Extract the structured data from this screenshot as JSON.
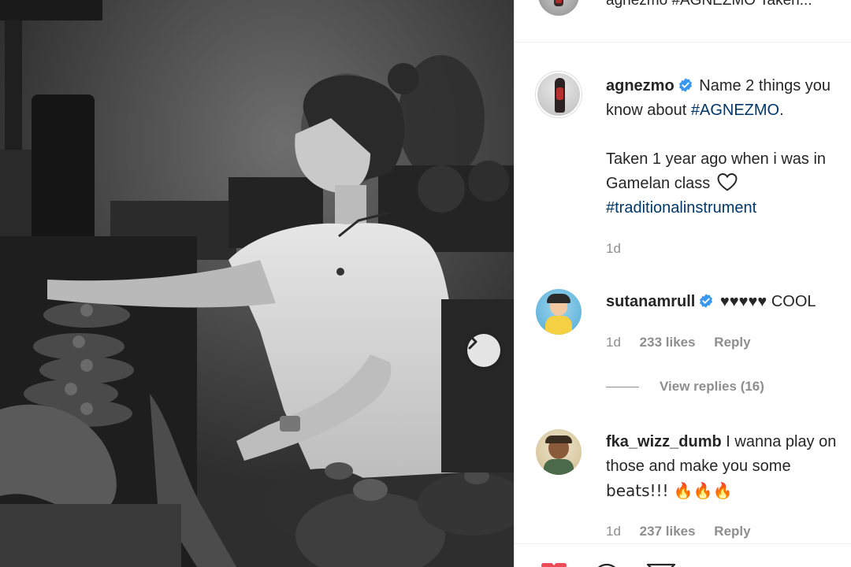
{
  "header": {
    "avatar_icon": "profile-avatar-icon",
    "caption_preview": "agnezmo #AGNEZMO Taken..."
  },
  "post": {
    "author": "agnezmo",
    "verified_icon": "verified-badge-icon",
    "caption_line1": "Name 2 things you",
    "caption_line2_prefix": "know about ",
    "hashtag1": "#AGNEZMO",
    "caption_line2_suffix": ".",
    "caption_line3": "Taken 1 year ago when i was in",
    "caption_line4": "Gamelan class",
    "heart_icon": "heart-outline-icon",
    "hashtag2": "#traditionalinstrument",
    "time": "1d"
  },
  "comments": [
    {
      "username": "sutanamrull",
      "text": "♥♥♥♥♥ COOL",
      "time": "1d",
      "likes": "233 likes",
      "reply_label": "Reply",
      "view_replies": "View replies (16)"
    },
    {
      "username": "fka_wizz_dumb",
      "text_line1": "I wanna play on",
      "text_line2": "those and make you some",
      "text_line3": "beats!!! 🔥🔥🔥",
      "time": "1d",
      "likes": "237 likes",
      "reply_label": "Reply"
    }
  ],
  "carousel": {
    "next_icon": "chevron-right-icon"
  },
  "colors": {
    "link": "#00376b",
    "verified": "#3897f0",
    "muted": "#8e8e8e"
  }
}
